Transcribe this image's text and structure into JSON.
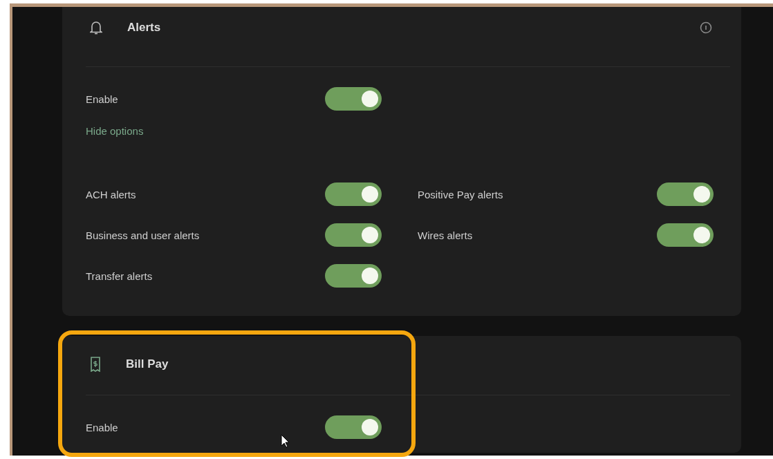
{
  "alerts": {
    "title": "Alerts",
    "enable": {
      "label": "Enable",
      "on": true
    },
    "hide_options": "Hide options",
    "options": [
      {
        "label": "ACH alerts",
        "on": true
      },
      {
        "label": "Positive Pay alerts",
        "on": true
      },
      {
        "label": "Business and user alerts",
        "on": true
      },
      {
        "label": "Wires alerts",
        "on": true
      },
      {
        "label": "Transfer alerts",
        "on": true
      }
    ]
  },
  "bill_pay": {
    "title": "Bill Pay",
    "highlighted": true,
    "enable": {
      "label": "Enable",
      "on": true
    }
  }
}
